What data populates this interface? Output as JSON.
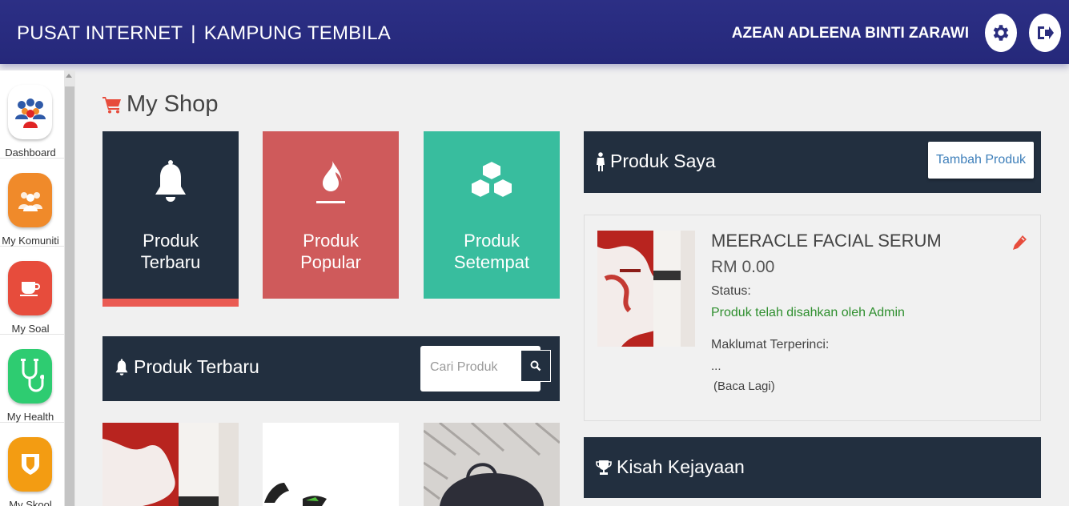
{
  "header": {
    "app_name": "PUSAT INTERNET",
    "separator": "|",
    "location": "KAMPUNG TEMBILA",
    "user_name": "AZEAN ADLEENA BINTI ZARAWI",
    "settings_icon": "gear-icon",
    "logout_icon": "sign-out-icon"
  },
  "sidebar": {
    "items": [
      {
        "label": "Dashboard",
        "icon": "people-group-icon",
        "color": "#ffffff"
      },
      {
        "label": "My Komuniti",
        "icon": "community-icon",
        "color": "#f08a2a"
      },
      {
        "label": "My Soal",
        "icon": "coffee-cup-icon",
        "color": "#e74c3c"
      },
      {
        "label": "My Health",
        "icon": "stethoscope-icon",
        "color": "#2ecc71"
      },
      {
        "label": "My Skool",
        "icon": "shield-icon",
        "color": "#f39c12"
      }
    ]
  },
  "page": {
    "title": "My Shop",
    "title_icon": "shopping-cart-icon"
  },
  "tiles": [
    {
      "label": "Produk\nTerbaru",
      "icon": "bell-icon",
      "color": "#222f3f",
      "active": true
    },
    {
      "label": "Produk\nPopular",
      "icon": "fire-icon",
      "color": "#cf5a5b",
      "active": false
    },
    {
      "label": "Produk\nSetempat",
      "icon": "cubes-icon",
      "color": "#38bd9e",
      "active": false
    }
  ],
  "produk_terbaru": {
    "title": "Produk Terbaru",
    "icon": "bell-icon",
    "search_placeholder": "Cari Produk",
    "search_icon": "search-icon"
  },
  "produk_saya": {
    "title": "Produk Saya",
    "icon": "male-icon",
    "add_button": "Tambah Produk",
    "product": {
      "name": "MEERACLE FACIAL SERUM",
      "price": "RM 0.00",
      "status_label": "Status:",
      "status": "Produk telah disahkan oleh Admin",
      "detail_label": "Maklumat Terperinci:",
      "detail": "...",
      "read_more": "(Baca Lagi)",
      "edit_icon": "pencil-icon"
    }
  },
  "kisah": {
    "title": "Kisah Kejayaan",
    "icon": "trophy-icon"
  },
  "thumbnails": [
    {
      "name": "serum-product-thumb"
    },
    {
      "name": "shoes-product-thumb"
    },
    {
      "name": "bag-product-thumb"
    }
  ]
}
